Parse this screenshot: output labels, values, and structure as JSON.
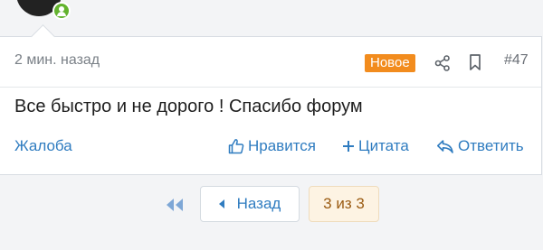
{
  "post": {
    "time": "2 мин. назад",
    "badge": "Новое",
    "number": "#47",
    "message": "Все быстро и не дорого ! Спасибо форум"
  },
  "actions": {
    "report": "Жалоба",
    "like": "Нравится",
    "quote": "Цитата",
    "reply": "Ответить"
  },
  "pagination": {
    "prev_label": "Назад",
    "page_status": "3 из 3"
  },
  "colors": {
    "accent": "#2f7cc0",
    "badge": "#f28c1e",
    "online": "#63b32e",
    "current_page_bg": "#fdf3e3",
    "current_page_text": "#9a5b12"
  },
  "icons": [
    "online-icon",
    "share-icon",
    "bookmark-icon",
    "thumbs-up-icon",
    "plus-icon",
    "reply-icon",
    "first-page-icon",
    "prev-arrow-icon"
  ]
}
